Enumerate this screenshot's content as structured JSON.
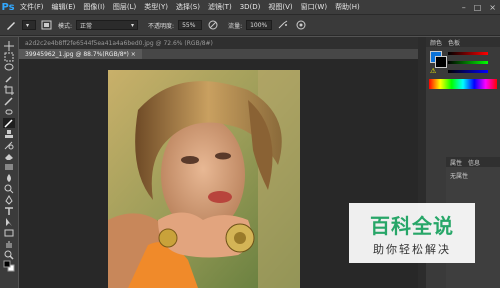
{
  "app": {
    "logo": "Ps"
  },
  "menu": [
    "文件(F)",
    "编辑(E)",
    "图像(I)",
    "图层(L)",
    "类型(Y)",
    "选择(S)",
    "滤镜(T)",
    "3D(D)",
    "视图(V)",
    "窗口(W)",
    "帮助(H)"
  ],
  "options": {
    "mode_label": "模式:",
    "mode_value": "正常",
    "opacity_label": "不透明度:",
    "opacity_value": "55%",
    "flow_label": "流量:",
    "flow_value": "100%"
  },
  "tabs": {
    "inactive": "a2d2c2e4b8ff2fe6544f5ea41a4a6bed0.jpg @ 72.6% (RGB/8#)",
    "active": "39945962_1.jpg @ 88.7%(RGB/8*) ×"
  },
  "panels": {
    "color_tab": "颜色",
    "swatches_tab": "色板",
    "properties_tab": "属性",
    "info_tab": "信息",
    "no_properties": "无属性"
  },
  "watermark": {
    "title": "百科全说",
    "subtitle": "助你轻松解决"
  },
  "colors": {
    "accent": "#31a8ff",
    "brand_green": "#27b06d"
  }
}
